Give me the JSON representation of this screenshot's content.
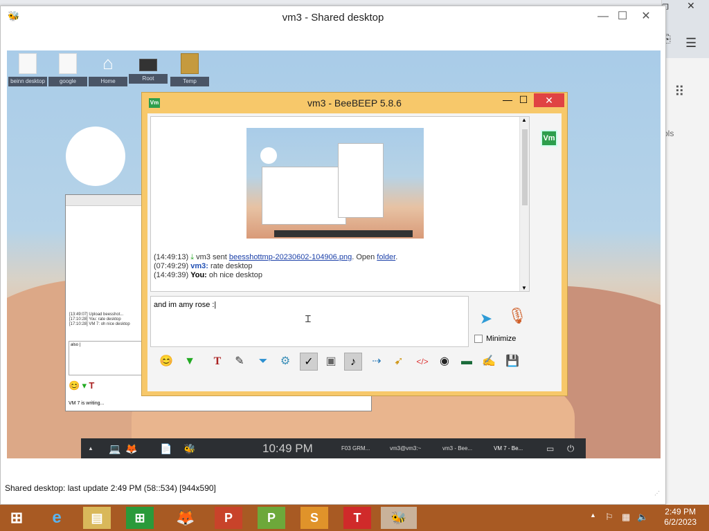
{
  "outer_window": {
    "title": "vm3 - Shared desktop",
    "status": "Shared desktop: last update 2:49 PM (58::534) [944x590]"
  },
  "remote_desktop": {
    "icons": [
      "beinn desktop",
      "google chrome.desk",
      "Home",
      "Root",
      "Temp"
    ]
  },
  "vm7_window": {
    "chat_lines": [
      "[13:49:07] Upload beesshot...",
      "[17:10:28] You: rate desktop",
      "[17:10:28] VM 7: oh nice desktop"
    ],
    "input": "also |",
    "status": "VM 7 is writing..."
  },
  "remote_taskbar": {
    "clock": "10:49 PM",
    "items": [
      "F03 GRM...",
      "vm3@vm3:~",
      "vm3 - Bee...",
      "VM 7 - Be..."
    ]
  },
  "beebeep": {
    "title": "vm3 - BeeBEEP 5.8.6",
    "logo": "Vm",
    "messages": [
      {
        "time": "(14:49:13)",
        "sender": "vm3",
        "pre": " sent ",
        "link": "beesshottmp-20230602-104906.png",
        "mid": ". Open ",
        "link2": "folder",
        "post": "."
      },
      {
        "time": "(07:49:29)",
        "sender": "vm3:",
        "text": " rate desktop"
      },
      {
        "time": "(14:49:39)",
        "sender": "You:",
        "text": " oh nice desktop"
      }
    ],
    "input_text": "and im amy rose :|",
    "minimize_label": "Minimize",
    "user_avatar": "Vm"
  },
  "windows_taskbar": {
    "time": "2:49 PM",
    "date": "6/2/2023"
  }
}
